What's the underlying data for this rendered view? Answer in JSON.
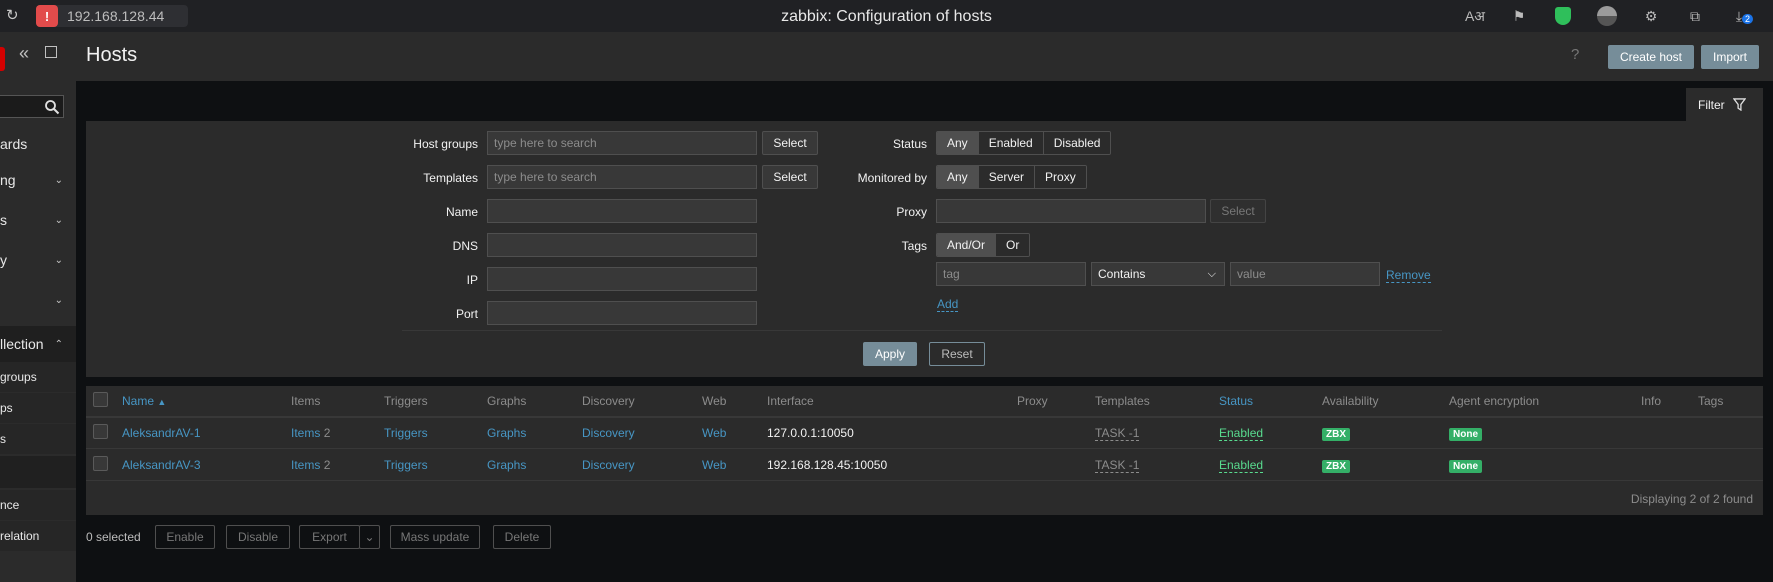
{
  "browser": {
    "url": "192.168.128.44",
    "title": "zabbix: Configuration of hosts",
    "download_badge": "2"
  },
  "sidebar": {
    "items": [
      {
        "label": "ards"
      },
      {
        "label": "ng"
      },
      {
        "label": "s"
      },
      {
        "label": "y"
      },
      {
        "label": ""
      },
      {
        "label": "llection"
      }
    ],
    "sub_items": [
      {
        "label": "groups"
      },
      {
        "label": "ps"
      },
      {
        "label": "s"
      },
      {
        "label": ""
      },
      {
        "label": "nce"
      },
      {
        "label": "relation"
      }
    ]
  },
  "header": {
    "title": "Hosts",
    "help": "?",
    "create_host": "Create host",
    "import": "Import"
  },
  "filter": {
    "tab_label": "Filter",
    "host_groups_label": "Host groups",
    "host_groups_placeholder": "type here to search",
    "templates_label": "Templates",
    "templates_placeholder": "type here to search",
    "select": "Select",
    "name_label": "Name",
    "dns_label": "DNS",
    "ip_label": "IP",
    "port_label": "Port",
    "status_label": "Status",
    "status_options": [
      "Any",
      "Enabled",
      "Disabled"
    ],
    "monitored_label": "Monitored by",
    "monitored_options": [
      "Any",
      "Server",
      "Proxy"
    ],
    "proxy_label": "Proxy",
    "tags_label": "Tags",
    "tags_options": [
      "And/Or",
      "Or"
    ],
    "tag_placeholder": "tag",
    "tag_operator": "Contains",
    "value_placeholder": "value",
    "remove": "Remove",
    "add": "Add",
    "apply": "Apply",
    "reset": "Reset"
  },
  "table": {
    "columns": {
      "name": "Name",
      "items": "Items",
      "triggers": "Triggers",
      "graphs": "Graphs",
      "discovery": "Discovery",
      "web": "Web",
      "interface": "Interface",
      "proxy": "Proxy",
      "templates": "Templates",
      "status": "Status",
      "availability": "Availability",
      "encryption": "Agent encryption",
      "info": "Info",
      "tags": "Tags"
    },
    "rows": [
      {
        "name": "AleksandrAV-1",
        "items": "Items",
        "items_count": "2",
        "triggers": "Triggers",
        "graphs": "Graphs",
        "discovery": "Discovery",
        "web": "Web",
        "interface": "127.0.0.1:10050",
        "template": "TASK -1",
        "status": "Enabled",
        "availability": "ZBX",
        "encryption": "None"
      },
      {
        "name": "AleksandrAV-3",
        "items": "Items",
        "items_count": "2",
        "triggers": "Triggers",
        "graphs": "Graphs",
        "discovery": "Discovery",
        "web": "Web",
        "interface": "192.168.128.45:10050",
        "template": "TASK -1",
        "status": "Enabled",
        "availability": "ZBX",
        "encryption": "None"
      }
    ],
    "footer": "Displaying 2 of 2 found"
  },
  "bottom": {
    "selected": "0 selected",
    "enable": "Enable",
    "disable": "Disable",
    "export": "Export",
    "mass_update": "Mass update",
    "delete": "Delete"
  }
}
